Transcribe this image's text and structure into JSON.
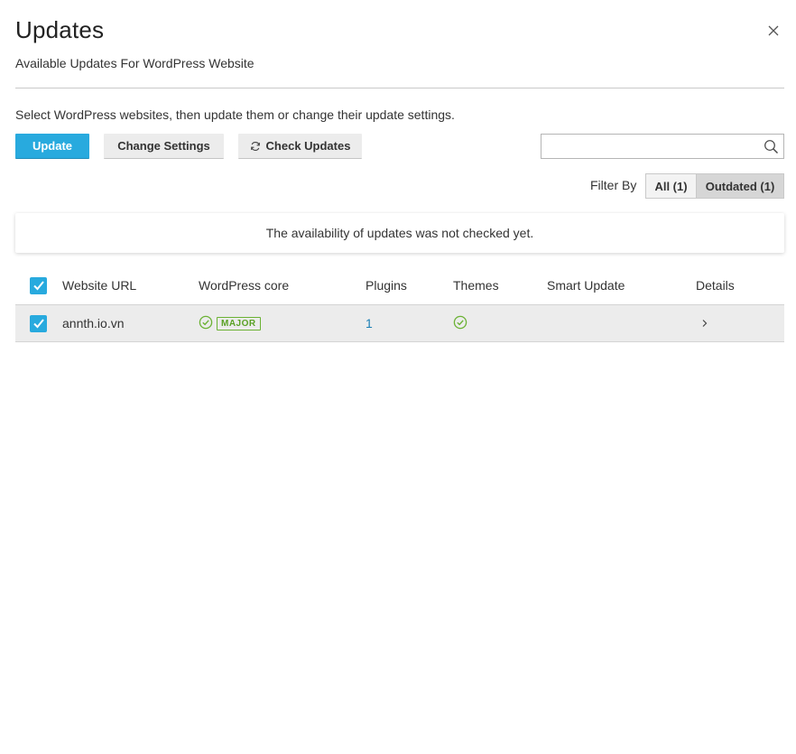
{
  "dialog": {
    "title": "Updates",
    "subtitle": "Available Updates For WordPress Website",
    "intro": "Select WordPress websites, then update them or change their update settings."
  },
  "toolbar": {
    "update_label": "Update",
    "settings_label": "Change Settings",
    "check_label": "Check Updates",
    "search_placeholder": ""
  },
  "filter": {
    "label": "Filter By",
    "options": [
      {
        "label": "All (1)",
        "selected": false
      },
      {
        "label": "Outdated (1)",
        "selected": true
      }
    ]
  },
  "notice": "The availability of updates was not checked yet.",
  "table": {
    "columns": [
      "Website URL",
      "WordPress core",
      "Plugins",
      "Themes",
      "Smart Update",
      "Details"
    ],
    "rows": [
      {
        "url": "annth.io.vn",
        "core_badge": "MAJOR",
        "plugins": "1",
        "smart_update": ""
      }
    ]
  },
  "colors": {
    "accent": "#28aade",
    "success": "#6bb234",
    "link": "#1a7fb5"
  }
}
